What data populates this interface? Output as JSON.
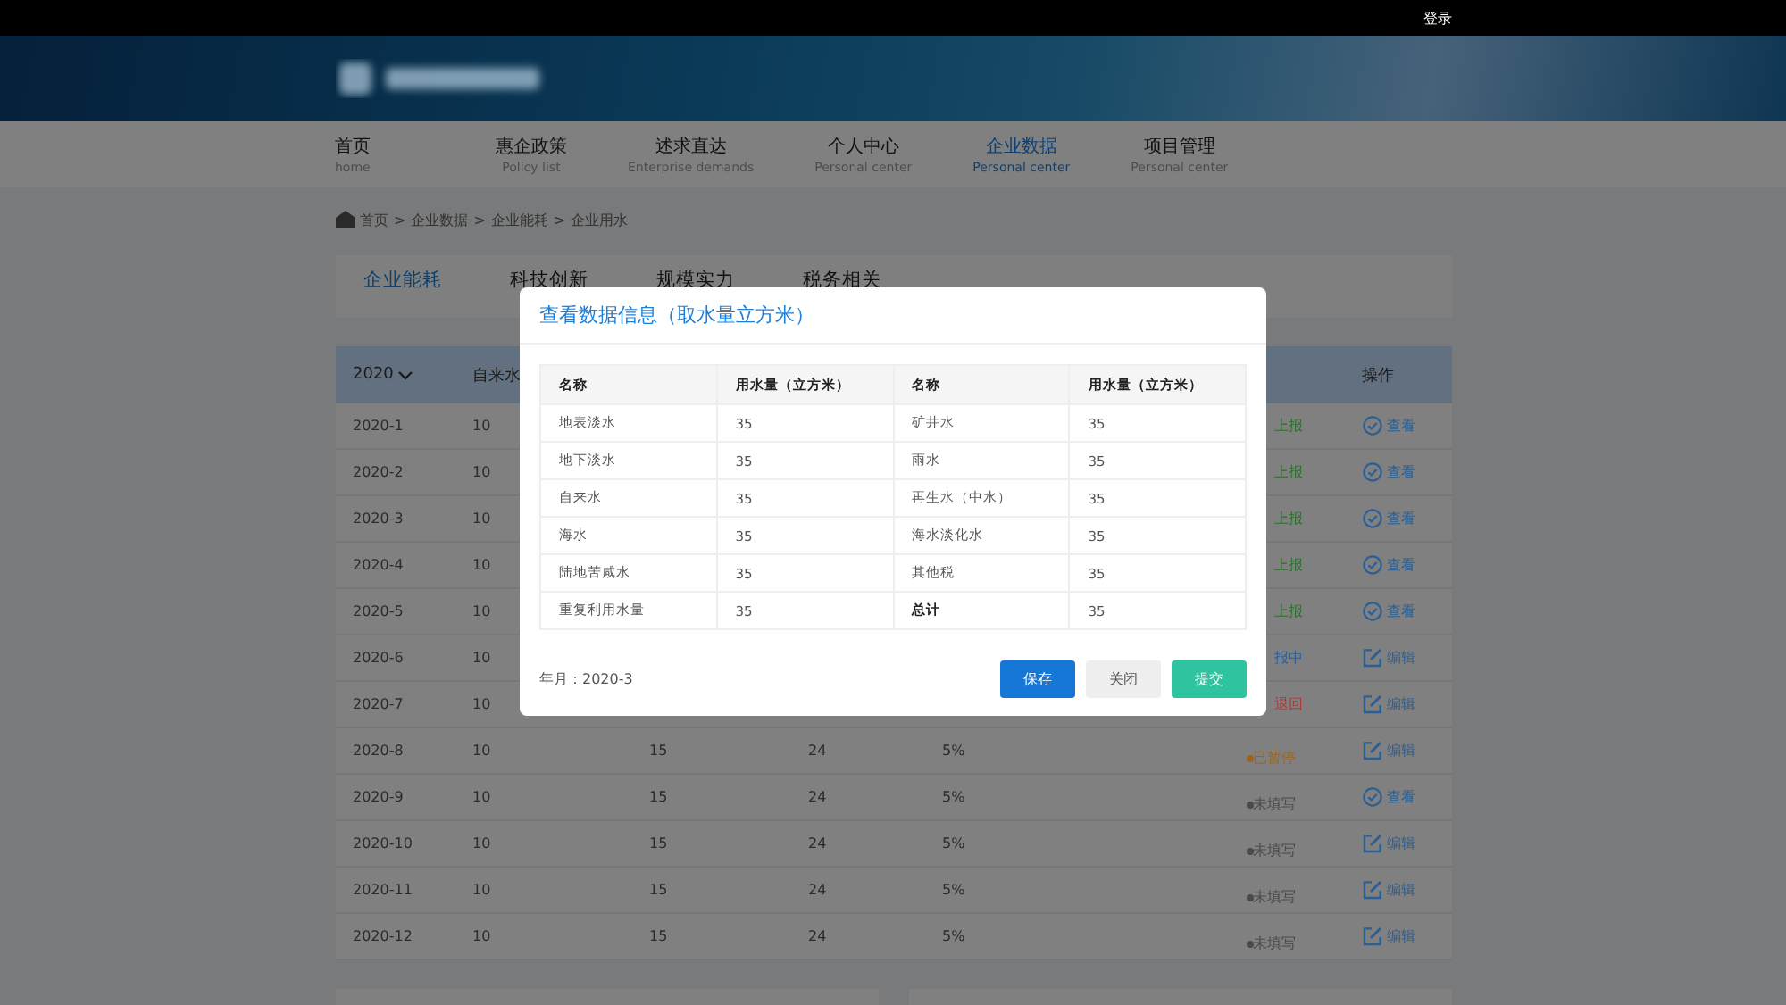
{
  "top_bar": {
    "login": "登录"
  },
  "nav": [
    {
      "label": "首页",
      "sub": "home",
      "selected": false
    },
    {
      "label": "惠企政策",
      "sub": "Policy list",
      "selected": false
    },
    {
      "label": "述求直达",
      "sub": "Enterprise demands",
      "selected": false
    },
    {
      "label": "个人中心",
      "sub": "Personal center",
      "selected": false
    },
    {
      "label": "企业数据",
      "sub": "Personal center",
      "selected": true
    },
    {
      "label": "项目管理",
      "sub": "Personal center",
      "selected": false
    }
  ],
  "breadcrumb": {
    "separator": ">",
    "items": [
      "首页",
      "企业数据",
      "企业能耗",
      "企业用水"
    ]
  },
  "tabs": [
    {
      "label": "企业能耗",
      "selected": true
    },
    {
      "label": "科技创新",
      "selected": false
    },
    {
      "label": "规模实力",
      "selected": false
    },
    {
      "label": "税务相关",
      "selected": false
    }
  ],
  "table": {
    "year": "2020",
    "column_2": "自来水",
    "action_header": "操作",
    "rows": [
      {
        "month": "2020-1",
        "values": [
          "10"
        ],
        "status": {
          "kind": "plain",
          "text": "上报",
          "color": "#2c6e2c"
        },
        "action": {
          "kind": "view",
          "label": "查看"
        }
      },
      {
        "month": "2020-2",
        "values": [
          "10"
        ],
        "status": {
          "kind": "plain",
          "text": "上报",
          "color": "#2c6e2c"
        },
        "action": {
          "kind": "view",
          "label": "查看"
        }
      },
      {
        "month": "2020-3",
        "values": [
          "10"
        ],
        "status": {
          "kind": "plain",
          "text": "上报",
          "color": "#2c6e2c"
        },
        "action": {
          "kind": "view",
          "label": "查看"
        }
      },
      {
        "month": "2020-4",
        "values": [
          "10"
        ],
        "status": {
          "kind": "plain",
          "text": "上报",
          "color": "#2c6e2c"
        },
        "action": {
          "kind": "view",
          "label": "查看"
        }
      },
      {
        "month": "2020-5",
        "values": [
          "10"
        ],
        "status": {
          "kind": "plain",
          "text": "上报",
          "color": "#2c6e2c"
        },
        "action": {
          "kind": "view",
          "label": "查看"
        }
      },
      {
        "month": "2020-6",
        "values": [
          "10"
        ],
        "status": {
          "kind": "plain",
          "text": "报中",
          "color": "#2a5f96"
        },
        "action": {
          "kind": "edit",
          "label": "编辑"
        }
      },
      {
        "month": "2020-7",
        "values": [
          "10"
        ],
        "status": {
          "kind": "plain",
          "text": "退回",
          "color": "#a83a3a"
        },
        "action": {
          "kind": "edit",
          "label": "编辑"
        }
      },
      {
        "month": "2020-8",
        "values": [
          "10",
          "15",
          "24",
          "5%"
        ],
        "status": {
          "kind": "dot",
          "text": "已暂停",
          "color": "#9a6420"
        },
        "action": {
          "kind": "edit",
          "label": "编辑"
        }
      },
      {
        "month": "2020-9",
        "values": [
          "10",
          "15",
          "24",
          "5%"
        ],
        "status": {
          "kind": "dot",
          "text": "未填写",
          "color": "#4a4a4a"
        },
        "action": {
          "kind": "view",
          "label": "查看"
        }
      },
      {
        "month": "2020-10",
        "values": [
          "10",
          "15",
          "24",
          "5%"
        ],
        "status": {
          "kind": "dot",
          "text": "未填写",
          "color": "#4a4a4a"
        },
        "action": {
          "kind": "edit",
          "label": "编辑"
        }
      },
      {
        "month": "2020-11",
        "values": [
          "10",
          "15",
          "24",
          "5%"
        ],
        "status": {
          "kind": "dot",
          "text": "未填写",
          "color": "#4a4a4a"
        },
        "action": {
          "kind": "edit",
          "label": "编辑"
        }
      },
      {
        "month": "2020-12",
        "values": [
          "10",
          "15",
          "24",
          "5%"
        ],
        "status": {
          "kind": "dot",
          "text": "未填写",
          "color": "#4a4a4a"
        },
        "action": {
          "kind": "edit",
          "label": "编辑"
        }
      }
    ]
  },
  "dialog": {
    "title": "查看数据信息（取水量立方米）",
    "columns": [
      "名称",
      "用水量（立方米）",
      "名称",
      "用水量（立方米）"
    ],
    "rows": [
      [
        {
          "text": "地表淡水",
          "bold": false
        },
        {
          "text": "35",
          "bold": false
        },
        {
          "text": "矿井水",
          "bold": false
        },
        {
          "text": "35",
          "bold": false
        }
      ],
      [
        {
          "text": "地下淡水",
          "bold": false
        },
        {
          "text": "35",
          "bold": false
        },
        {
          "text": "雨水",
          "bold": false
        },
        {
          "text": "35",
          "bold": false
        }
      ],
      [
        {
          "text": "自来水",
          "bold": false
        },
        {
          "text": "35",
          "bold": false
        },
        {
          "text": "再生水（中水）",
          "bold": false
        },
        {
          "text": "35",
          "bold": false
        }
      ],
      [
        {
          "text": "海水",
          "bold": false
        },
        {
          "text": "35",
          "bold": false
        },
        {
          "text": "海水淡化水",
          "bold": false
        },
        {
          "text": "35",
          "bold": false
        }
      ],
      [
        {
          "text": "陆地苦咸水",
          "bold": false
        },
        {
          "text": "35",
          "bold": false
        },
        {
          "text": "其他税",
          "bold": false
        },
        {
          "text": "35",
          "bold": false
        }
      ],
      [
        {
          "text": "重复利用水量",
          "bold": false
        },
        {
          "text": "35",
          "bold": false
        },
        {
          "text": "总计",
          "bold": true
        },
        {
          "text": "35",
          "bold": false
        }
      ]
    ],
    "period": "年月：2020-3",
    "buttons": [
      {
        "label": "保存",
        "kind": "primary"
      },
      {
        "label": "关闭",
        "kind": "default"
      },
      {
        "label": "提交",
        "kind": "success"
      }
    ]
  }
}
